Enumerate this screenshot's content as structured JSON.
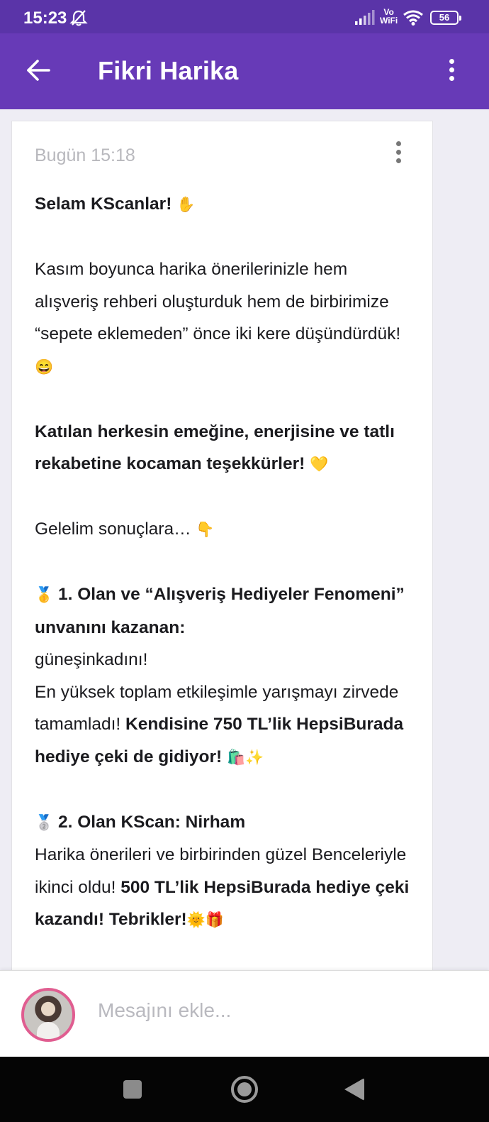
{
  "status_bar": {
    "time": "15:23",
    "network": "Vo\nWiFi",
    "battery": "56"
  },
  "app_bar": {
    "title": "Fikri Harika"
  },
  "post": {
    "timestamp": "Bugün 15:18",
    "greeting": "Selam KScanlar!",
    "greeting_emoji": "✋",
    "p1": "Kasım boyunca harika önerilerinizle hem alışveriş rehberi oluşturduk hem de birbirimize “sepete eklemeden” önce iki kere düşündürdük!",
    "p1_emoji": "😄",
    "thanks": "Katılan herkesin emeğine, enerjisine ve tatlı rekabetine kocaman teşekkürler!",
    "thanks_emoji": "💛",
    "results_intro": "Gelelim sonuçlara…",
    "results_emoji": "👇",
    "first_medal": "🥇",
    "first_title": "1. Olan ve “Alışveriş Hediyeler Fenomeni” unvanını kazanan:",
    "first_name": "güneşinkadını!",
    "first_desc": "En yüksek toplam etkileşimle yarışmayı zirvede tamamladı!",
    "first_prize": "Kendisine 750 TL’lik HepsiBurada hediye çeki de gidiyor!",
    "first_emoji": "🛍️✨",
    "second_medal": "🥈",
    "second_title": "2. Olan KScan: Nirham",
    "second_desc": "Harika önerileri ve birbirinden güzel Benceleriyle ikinci oldu!",
    "second_prize": "500 TL’lik HepsiBurada hediye çeki kazandı! Tebrikler!",
    "second_emoji": "🌞🎁"
  },
  "composer": {
    "placeholder": "Mesajını ekle..."
  }
}
